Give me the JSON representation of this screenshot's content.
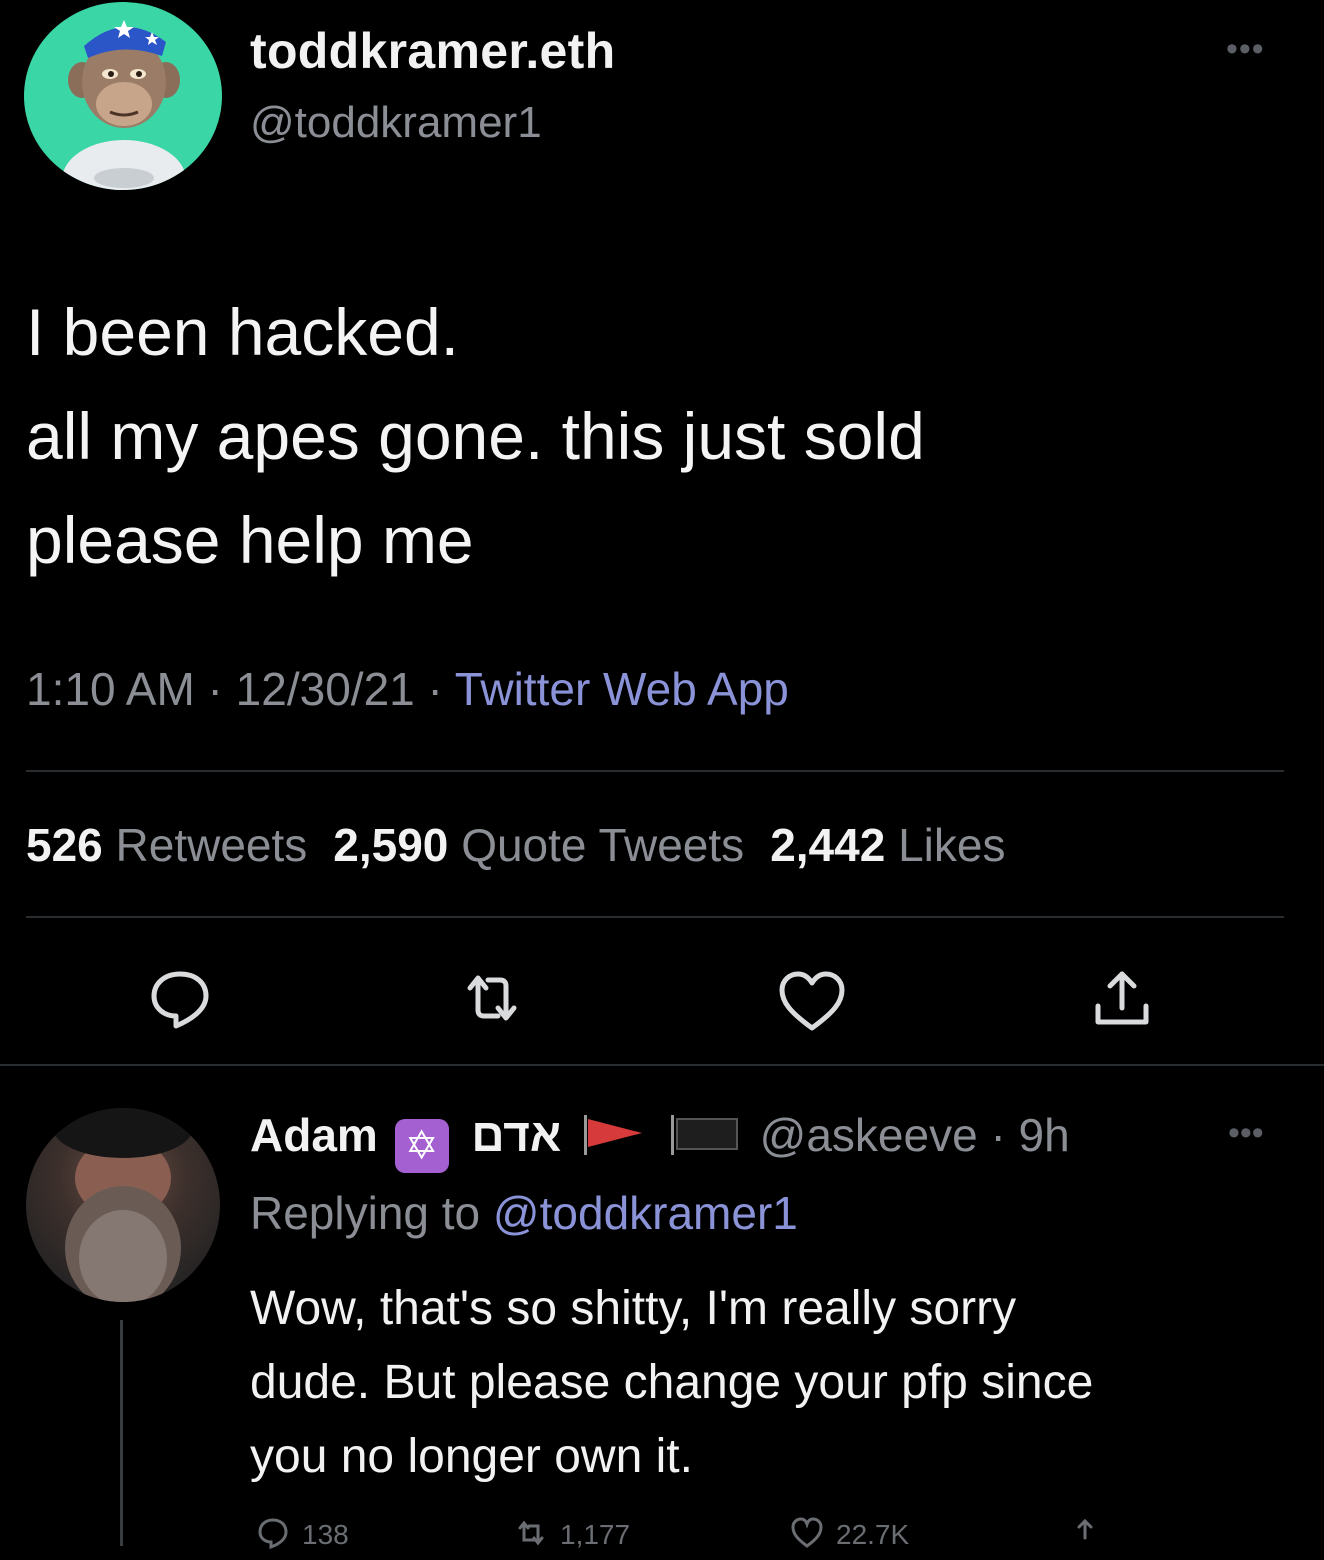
{
  "tweet": {
    "author": {
      "display_name": "toddkramer.eth",
      "handle": "@toddkramer1"
    },
    "more_icon": "ellipsis-icon",
    "text_lines": [
      "I been hacked.",
      "all my apes gone. this just sold",
      "please help me"
    ],
    "time": "1:10 AM",
    "date": "12/30/21",
    "separator": " · ",
    "source": "Twitter Web App",
    "stats": {
      "retweets_count": "526",
      "retweets_label": "Retweets",
      "quotes_count": "2,590",
      "quotes_label": "Quote Tweets",
      "likes_count": "2,442",
      "likes_label": "Likes"
    },
    "actions": [
      "reply-icon",
      "retweet-icon",
      "like-icon",
      "share-icon"
    ]
  },
  "reply": {
    "display_name": "Adam",
    "badge": "✡",
    "hebrew_name": "אדם",
    "handle_time": "@askeeve · 9h",
    "replying_prefix": "Replying to",
    "replying_mention": "@toddkramer1",
    "text_lines": [
      "Wow, that's so shitty, I'm really sorry",
      "dude. But please change your pfp since",
      "you no longer own it."
    ],
    "counts": {
      "replies": "138",
      "retweets": "1,177",
      "likes": "22.7K"
    }
  },
  "colors": {
    "background": "#000000",
    "link": "#8b93d8",
    "muted": "#8b8f95",
    "avatar_bg": "#3bd6a6",
    "badge": "#a45fd0"
  }
}
